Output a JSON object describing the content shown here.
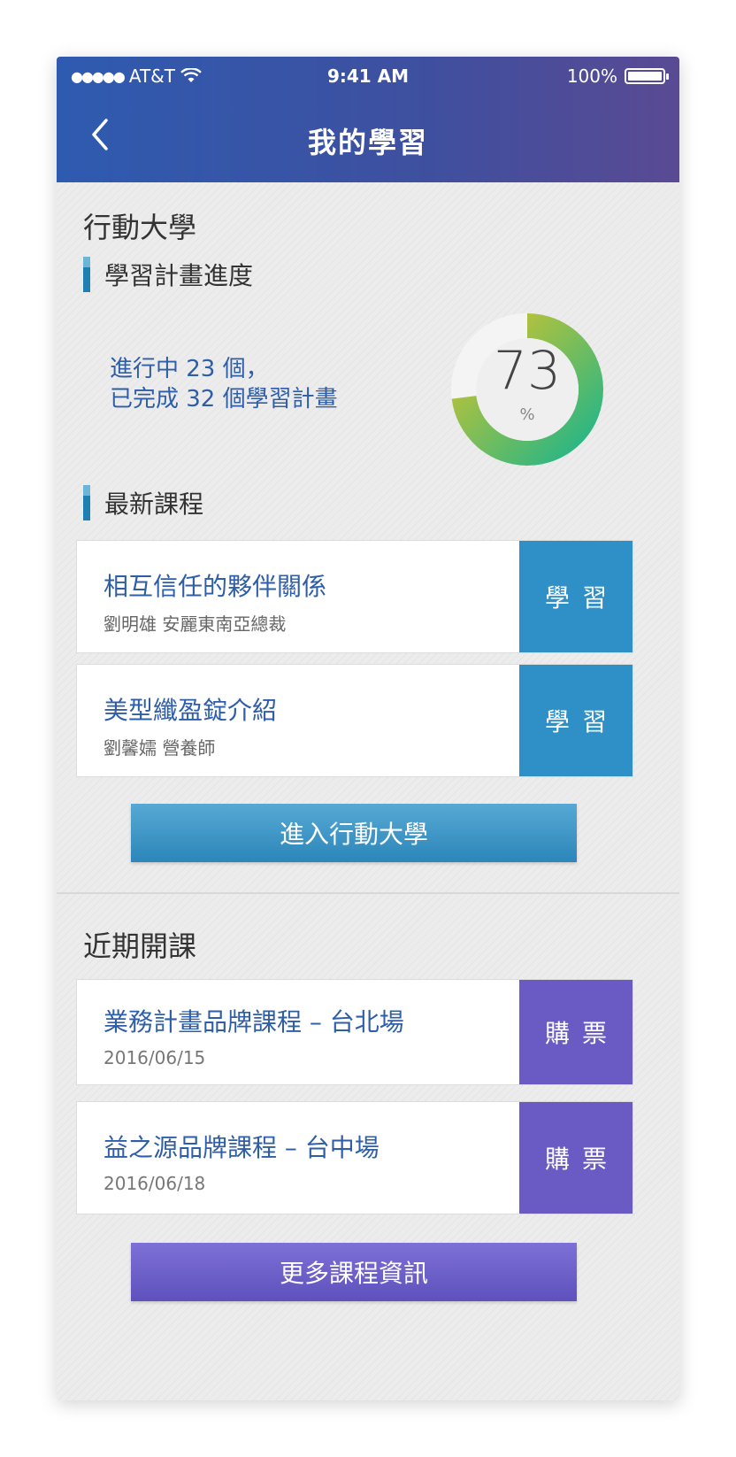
{
  "status_bar": {
    "signal": "●●●●●",
    "carrier": "AT&T",
    "time": "9:41 AM",
    "battery": "100%"
  },
  "nav": {
    "title": "我的學習"
  },
  "mobile_university": {
    "heading": "行動大學",
    "plan_progress": {
      "section_title": "學習計畫進度",
      "line1": "進行中 23 個，",
      "line2": "已完成 32 個學習計畫",
      "percent": 73,
      "percent_text": "73",
      "percent_sign": "%"
    },
    "latest_courses": {
      "section_title": "最新課程",
      "items": [
        {
          "title": "相互信任的夥伴關係",
          "subtitle": "劉明雄  安麗東南亞總裁",
          "action": "學習"
        },
        {
          "title": "美型纖盈錠介紹",
          "subtitle": "劉馨嬬  營養師",
          "action": "學習"
        }
      ]
    },
    "enter_button": "進入行動大學"
  },
  "upcoming": {
    "heading": "近期開課",
    "items": [
      {
        "title": "業務計畫品牌課程 – 台北場",
        "date": "2016/06/15",
        "action": "購票"
      },
      {
        "title": "益之源品牌課程 – 台中場",
        "date": "2016/06/18",
        "action": "購票"
      }
    ],
    "more_button": "更多課程資訊"
  },
  "colors": {
    "nav_start": "#2e5bb0",
    "nav_end": "#5a4a93",
    "blue": "#2e90c6",
    "purple": "#6a5bc4",
    "ring_start": "#1fb58a",
    "ring_end": "#d6c52a"
  },
  "icons": {
    "back": "chevron-left-icon",
    "wifi": "wifi-icon",
    "battery": "battery-icon"
  }
}
